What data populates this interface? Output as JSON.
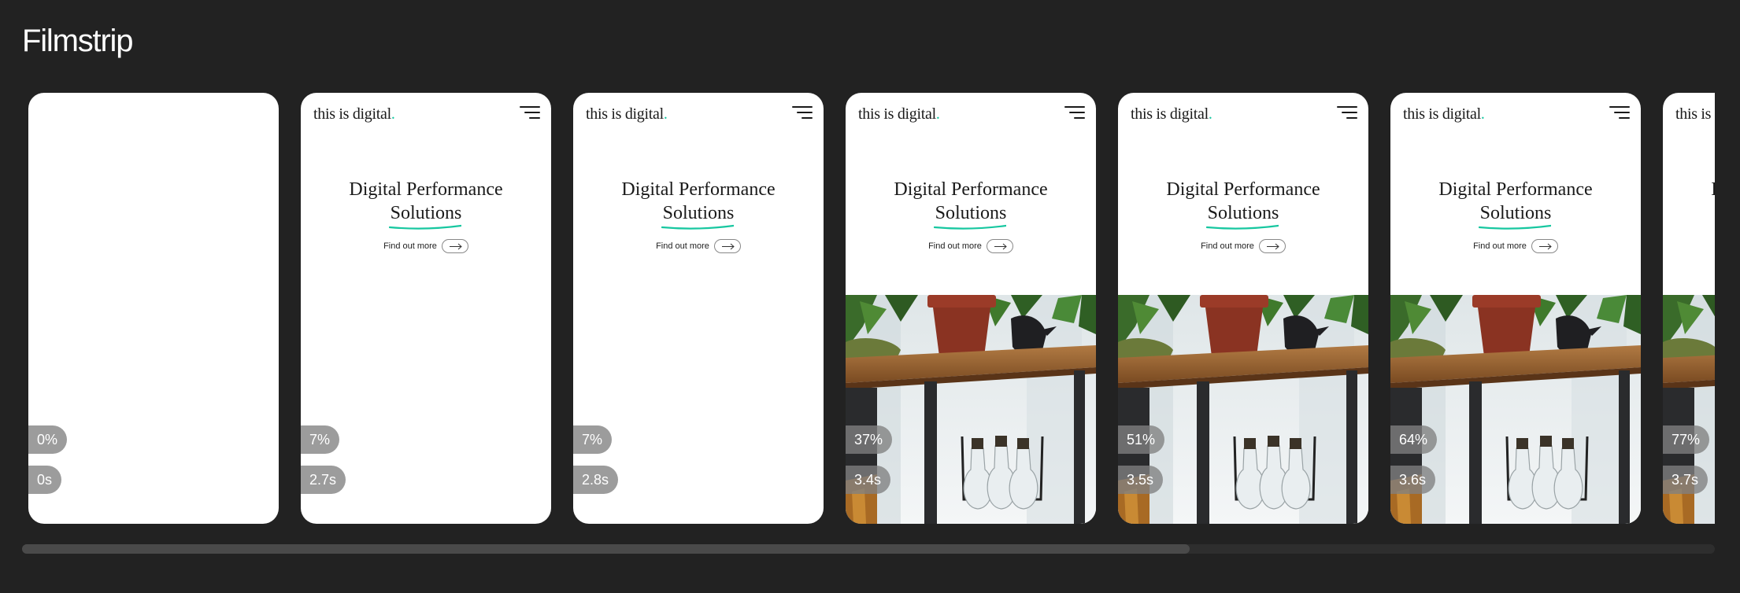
{
  "page": {
    "title": "Filmstrip"
  },
  "site": {
    "logo_text": "this is digital",
    "logo_dot": ".",
    "hero_line1": "Digital Performance",
    "hero_line2": "Solutions",
    "cta_label": "Find out more",
    "accent_color": "#17c7a0"
  },
  "frames": [
    {
      "progress": "0%",
      "time": "0s",
      "state": "blank"
    },
    {
      "progress": "7%",
      "time": "2.7s",
      "state": "text"
    },
    {
      "progress": "7%",
      "time": "2.8s",
      "state": "text"
    },
    {
      "progress": "37%",
      "time": "3.4s",
      "state": "image"
    },
    {
      "progress": "51%",
      "time": "3.5s",
      "state": "image"
    },
    {
      "progress": "64%",
      "time": "3.6s",
      "state": "image"
    },
    {
      "progress": "77%",
      "time": "3.7s",
      "state": "image"
    }
  ],
  "scrollbar": {
    "position": 0.69
  }
}
